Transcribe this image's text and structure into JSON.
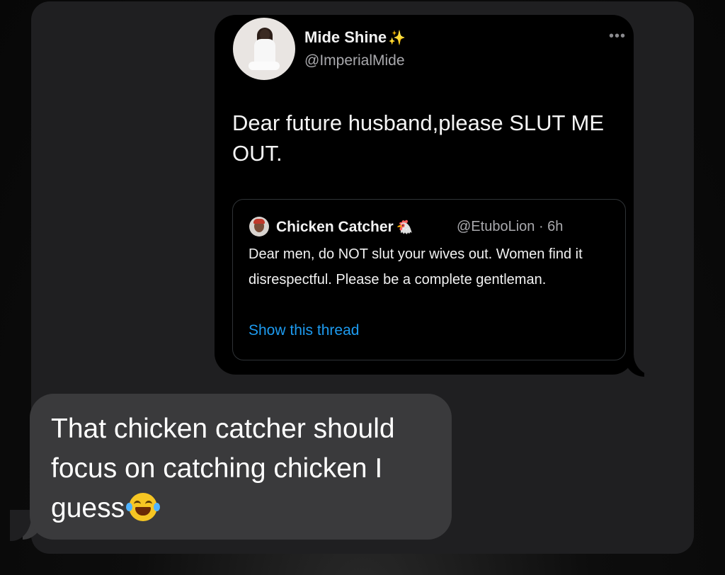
{
  "tweet": {
    "author_name": "Mide Shine",
    "author_emoji": "✨",
    "author_handle": "@ImperialMide",
    "more_icon": "•••",
    "text": "Dear future husband,please SLUT ME OUT.",
    "quote": {
      "author_name": "Chicken Catcher",
      "author_emoji": "🐔",
      "meta": "@EtuboLion · 6h",
      "text": "Dear men, do NOT slut your wives out. Women find it disrespectful. Please be a complete gentleman.",
      "link_label": "Show this thread",
      "link_color": "#1d9bf0"
    }
  },
  "message": {
    "text": "That chicken catcher should focus on catching chicken I guess",
    "emoji": "face-with-tears-of-joy"
  },
  "colors": {
    "outgoing_bubble": "#000000",
    "incoming_bubble": "#3a3a3c",
    "background": "#1f1f21"
  }
}
